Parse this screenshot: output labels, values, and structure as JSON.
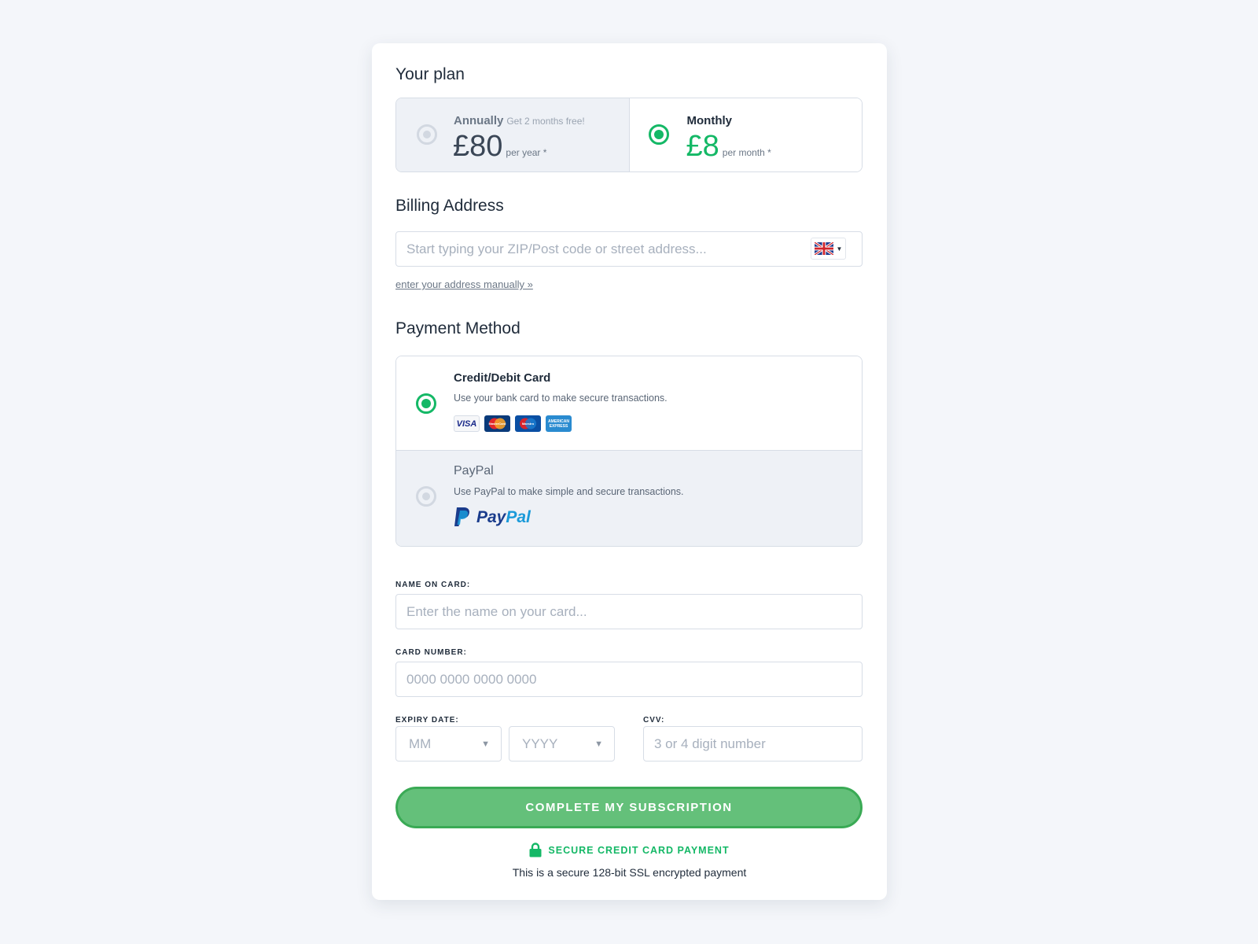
{
  "colors": {
    "accent": "#14b866",
    "button": "#64c07a",
    "page_background": "#f4f6fa"
  },
  "plan": {
    "title": "Your plan",
    "options": [
      {
        "name": "Annually",
        "badge": "Get 2 months free!",
        "price": "£80",
        "unit": "per year *",
        "selected": false
      },
      {
        "name": "Monthly",
        "badge": "",
        "price": "£8",
        "unit": "per month *",
        "selected": true
      }
    ]
  },
  "billing": {
    "title": "Billing Address",
    "address_placeholder": "Start typing your ZIP/Post code or street address...",
    "address_value": "",
    "country_icon": "uk-flag-icon",
    "manual_link": "enter your address manually »"
  },
  "payment": {
    "title": "Payment Method",
    "methods": [
      {
        "name": "Credit/Debit Card",
        "description": "Use your bank card to make secure transactions.",
        "selected": true,
        "logos": [
          "VISA",
          "MasterCard",
          "Maestro",
          "AMERICAN EXPRESS"
        ]
      },
      {
        "name": "PayPal",
        "description": "Use PayPal to make simple and secure transactions.",
        "selected": false,
        "logo_text_1": "Pay",
        "logo_text_2": "Pal"
      }
    ]
  },
  "form": {
    "name_label": "NAME ON CARD:",
    "name_placeholder": "Enter the name on your card...",
    "number_label": "CARD NUMBER:",
    "number_placeholder": "0000 0000 0000 0000",
    "expiry_label": "EXPIRY DATE:",
    "month_value": "MM",
    "year_value": "YYYY",
    "cvv_label": "CVV:",
    "cvv_placeholder": "3 or 4 digit number"
  },
  "submit": {
    "label": "COMPLETE MY SUBSCRIPTION"
  },
  "secure": {
    "title": "SECURE CREDIT CARD PAYMENT",
    "note": "This is a secure 128-bit SSL encrypted payment",
    "icon": "lock-icon"
  }
}
